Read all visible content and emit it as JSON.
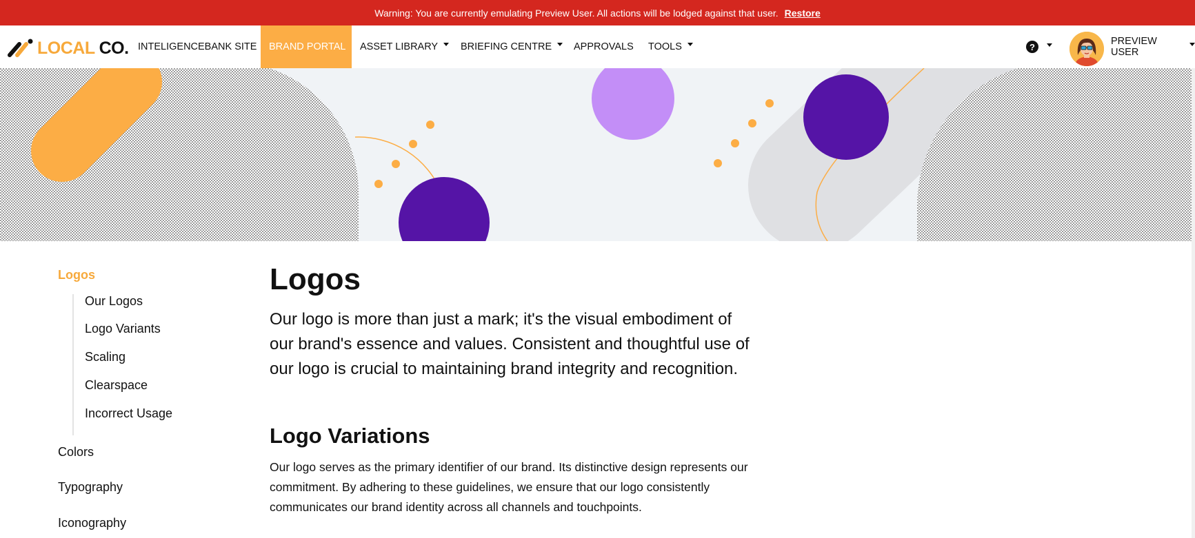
{
  "warning": {
    "message": "Warning: You are currently emulating Preview User. All actions will be lodged against that user.",
    "restore_link": "Restore"
  },
  "brand": {
    "logo_local": "LOCAL",
    "logo_co": "CO."
  },
  "nav": {
    "items": [
      {
        "label": "INTELIGENCEBANK SITE"
      },
      {
        "label": "BRAND PORTAL"
      },
      {
        "label": "ASSET LIBRARY"
      },
      {
        "label": "BRIEFING CENTRE"
      },
      {
        "label": "APPROVALS"
      },
      {
        "label": "TOOLS"
      }
    ],
    "active": "BRAND PORTAL",
    "help_icon": "?",
    "user_name": "PREVIEW USER"
  },
  "colors": {
    "warning_bg": "#d4271f",
    "accent_orange": "#fcad45",
    "purple_dark": "#5514a6",
    "purple_light": "#c38ef7",
    "hero_bg": "#f0f3f6"
  },
  "sidebar": {
    "active_item": "Logos",
    "sub_items": [
      "Our Logos",
      "Logo Variants",
      "Scaling",
      "Clearspace",
      "Incorrect Usage"
    ],
    "items": [
      "Colors",
      "Typography",
      "Iconography"
    ]
  },
  "main": {
    "title": "Logos",
    "intro": "Our logo is more than just a mark; it's the visual embodiment of our brand's essence and values. Consistent and thoughtful use of our logo is crucial to maintaining brand integrity and recognition.",
    "section_title": "Logo Variations",
    "section_body": "Our logo serves as the primary identifier of our brand. Its distinctive design represents our commitment. By adhering to these guidelines, we ensure that our logo consistently communicates our brand identity across all channels and touchpoints."
  }
}
